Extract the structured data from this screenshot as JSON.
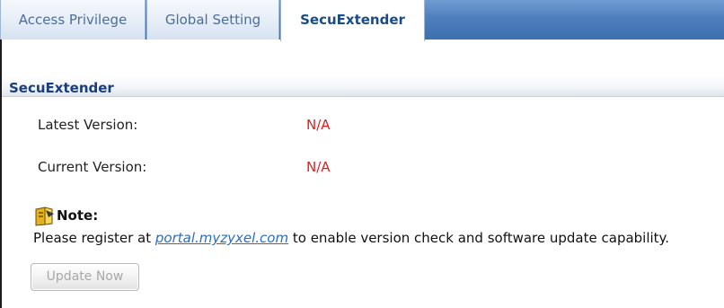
{
  "tabs": [
    {
      "label": "Access Privilege",
      "active": false
    },
    {
      "label": "Global Setting",
      "active": false
    },
    {
      "label": "SecuExtender",
      "active": true
    }
  ],
  "section": {
    "title": "SecuExtender"
  },
  "fields": {
    "latest_version_label": "Latest Version:",
    "latest_version_value": "N/A",
    "current_version_label": "Current Version:",
    "current_version_value": "N/A"
  },
  "note": {
    "icon": "note-icon",
    "title": "Note:",
    "text_before": "Please register at ",
    "link_text": "portal.myzyxel.com",
    "text_after": " to enable version check and software update capability."
  },
  "buttons": {
    "update_now": "Update Now",
    "update_now_enabled": false
  },
  "colors": {
    "tabbar": "#4f7fbd",
    "active_tab_text": "#1a4d88",
    "value_text": "#e02020",
    "link": "#2b6cc4",
    "section_title": "#1a3d7c"
  }
}
